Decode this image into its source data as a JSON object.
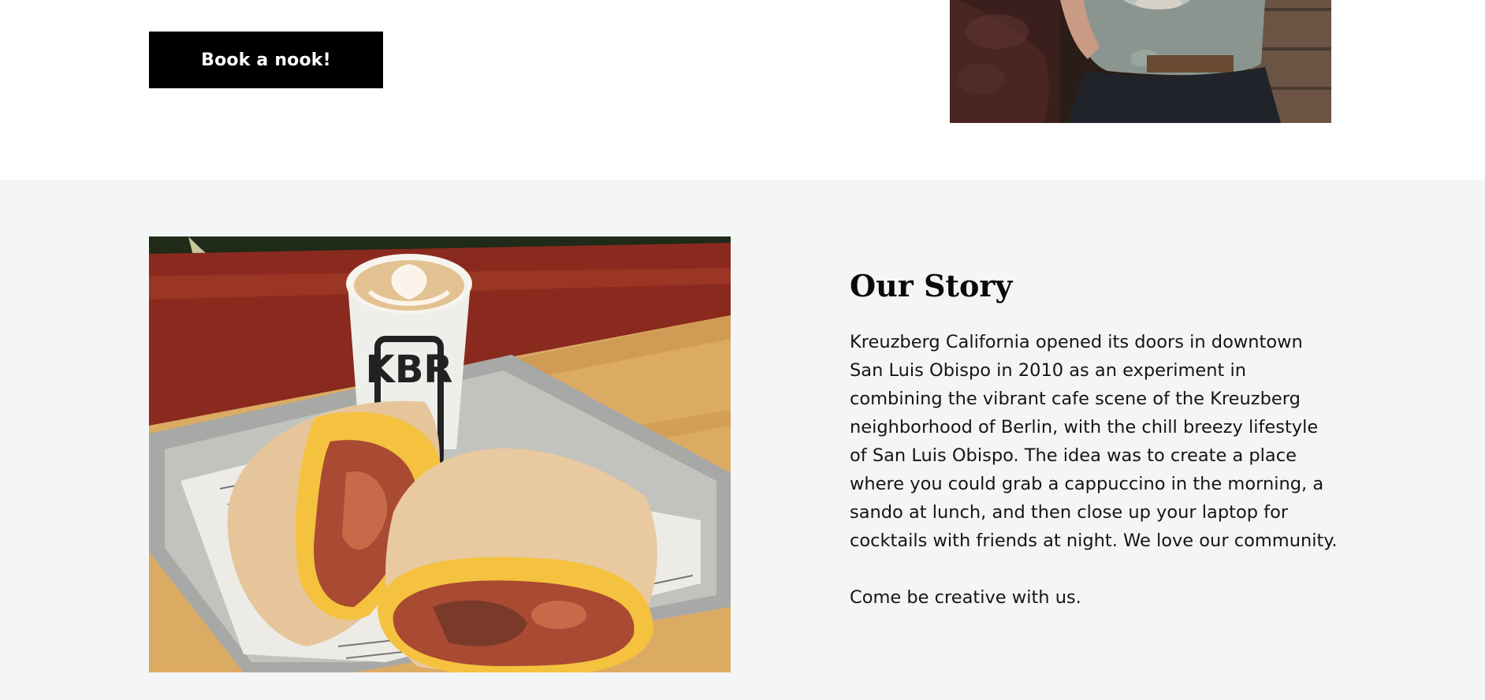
{
  "book_section": {
    "button_label": "Book a nook!"
  },
  "story": {
    "title": "Our Story",
    "paragraph_1": "Kreuzberg California opened its doors in downtown San Luis Obispo in 2010 as an experiment in combining the vibrant cafe scene of the Kreuzberg neighborhood of Berlin, with the chill breezy lifestyle of San Luis Obispo. The idea was to create a place where you could grab a cappuccino in the morning, a sando at lunch, and then close up your laptop for cocktails with friends at night. We love our community.",
    "paragraph_2": "Come be creative with us.",
    "cup_text": "KBR"
  },
  "colors": {
    "button_bg": "#000000",
    "section_bg": "#f4f5f7"
  }
}
